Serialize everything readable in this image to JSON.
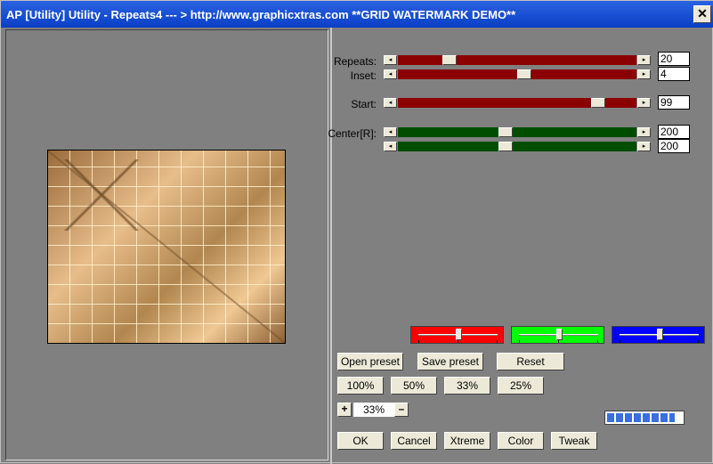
{
  "window": {
    "title": "AP [Utility]  Utility - Repeats4    --- > http://www.graphicxtras.com    **GRID WATERMARK DEMO**",
    "close_glyph": "✕"
  },
  "sliders": [
    {
      "label": "Repeats:",
      "value": "20",
      "position": 0.2,
      "color": "#8b0000"
    },
    {
      "label": "Inset:",
      "value": "4",
      "position": 0.53,
      "color": "#8b0000"
    },
    {
      "label": "Start:",
      "value": "99",
      "position": 0.86,
      "color": "#8b0000"
    },
    {
      "label": "Center[R]:",
      "value": "200",
      "position": 0.45,
      "color": "#004d00"
    },
    {
      "label": "",
      "value": "200",
      "position": 0.45,
      "color": "#004d00"
    }
  ],
  "arrows": {
    "left": "◂",
    "right": "▸"
  },
  "color_bars": [
    {
      "name": "red",
      "color": "#ff0000",
      "position": 0.5
    },
    {
      "name": "green",
      "color": "#00ff00",
      "position": 0.5
    },
    {
      "name": "blue",
      "color": "#0000ff",
      "position": 0.5
    }
  ],
  "buttons": {
    "open_preset": "Open preset",
    "save_preset": "Save preset",
    "reset": "Reset",
    "zoom100": "100%",
    "zoom50": "50%",
    "zoom33": "33%",
    "zoom25": "25%",
    "ok": "OK",
    "cancel": "Cancel",
    "xtreme": "Xtreme",
    "color": "Color",
    "tweak": "Tweak"
  },
  "zoom": {
    "plus": "+",
    "minus": "–",
    "value": "33%"
  },
  "progress": {
    "fraction": 0.9
  }
}
